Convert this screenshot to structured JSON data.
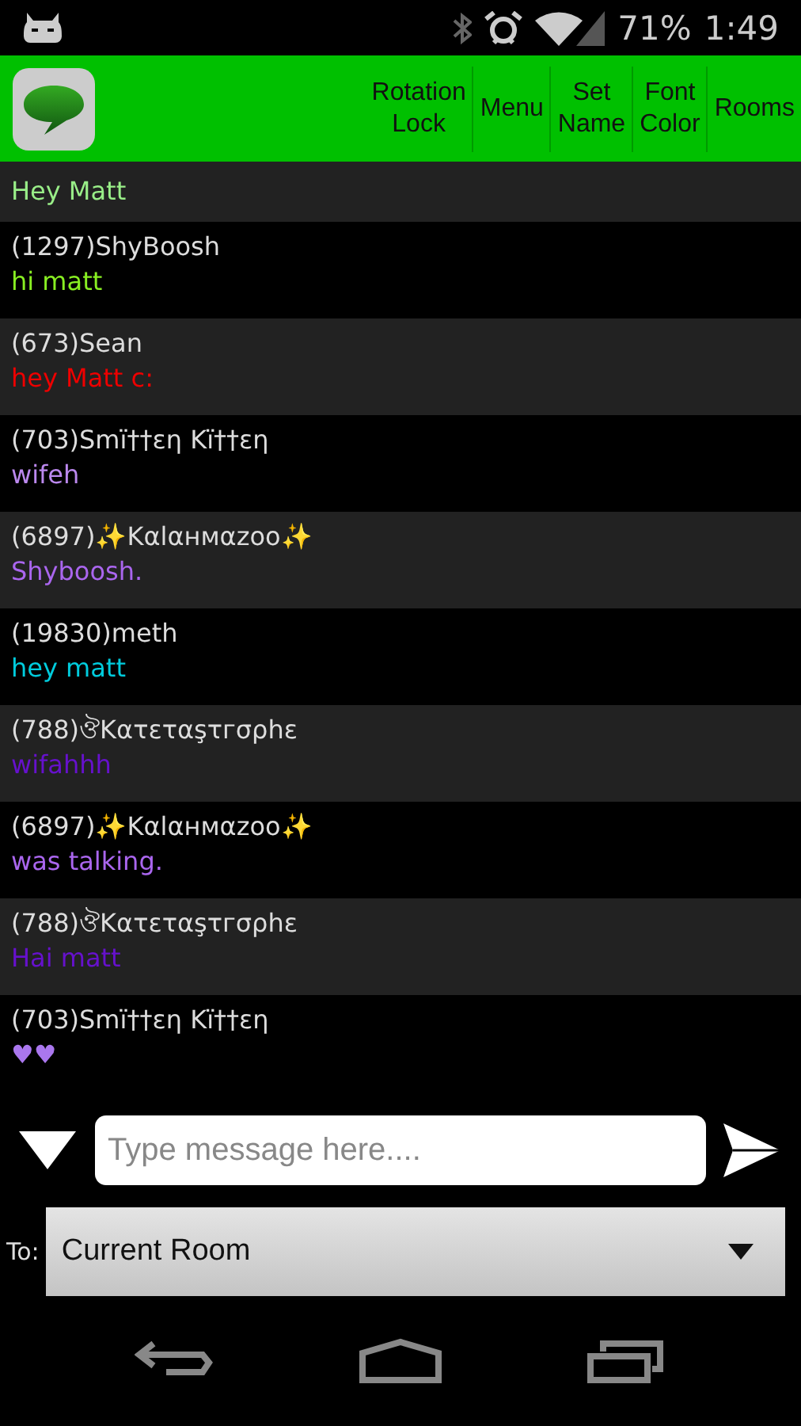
{
  "status_bar": {
    "battery": "71%",
    "time": "1:49"
  },
  "header": {
    "buttons": [
      "Rotation Lock",
      "Menu",
      "Set Name",
      "Font Color",
      "Rooms"
    ]
  },
  "messages": [
    {
      "message": "Hey Matt",
      "color": "#99ee88"
    },
    {
      "sender": "(1297)ShyBoosh",
      "message": "hi matt",
      "color": "#88ee22"
    },
    {
      "sender": "(673)Sean",
      "message": "hey Matt c:",
      "color": "#ee0000"
    },
    {
      "sender": "(703)Smï††εη Kï††εη",
      "message": "wifeh",
      "color": "#bb88ee"
    },
    {
      "sender": "(6897)✨Kαlαнмαzoo✨",
      "message": "Shyboosh.",
      "color": "#aa66ee"
    },
    {
      "sender": "(19830)meth",
      "message": "hey matt",
      "color": "#00ccdd"
    },
    {
      "sender": "(788)ঔKατεταşτгσρhε",
      "message": "wifahhh",
      "color": "#6611cc"
    },
    {
      "sender": "(6897)✨Kαlαнмαzoo✨",
      "message": "was talking.",
      "color": "#aa66ee"
    },
    {
      "sender": "(788)ঔKατεταşτгσρhε",
      "message": "Hai matt",
      "color": "#6611cc"
    },
    {
      "sender": "(703)Smï††εη Kï††εη",
      "message": "♥♥",
      "color": "#aa77ee"
    }
  ],
  "composer": {
    "placeholder": "Type message here...."
  },
  "recipient": {
    "label": "To:",
    "value": "Current Room"
  }
}
